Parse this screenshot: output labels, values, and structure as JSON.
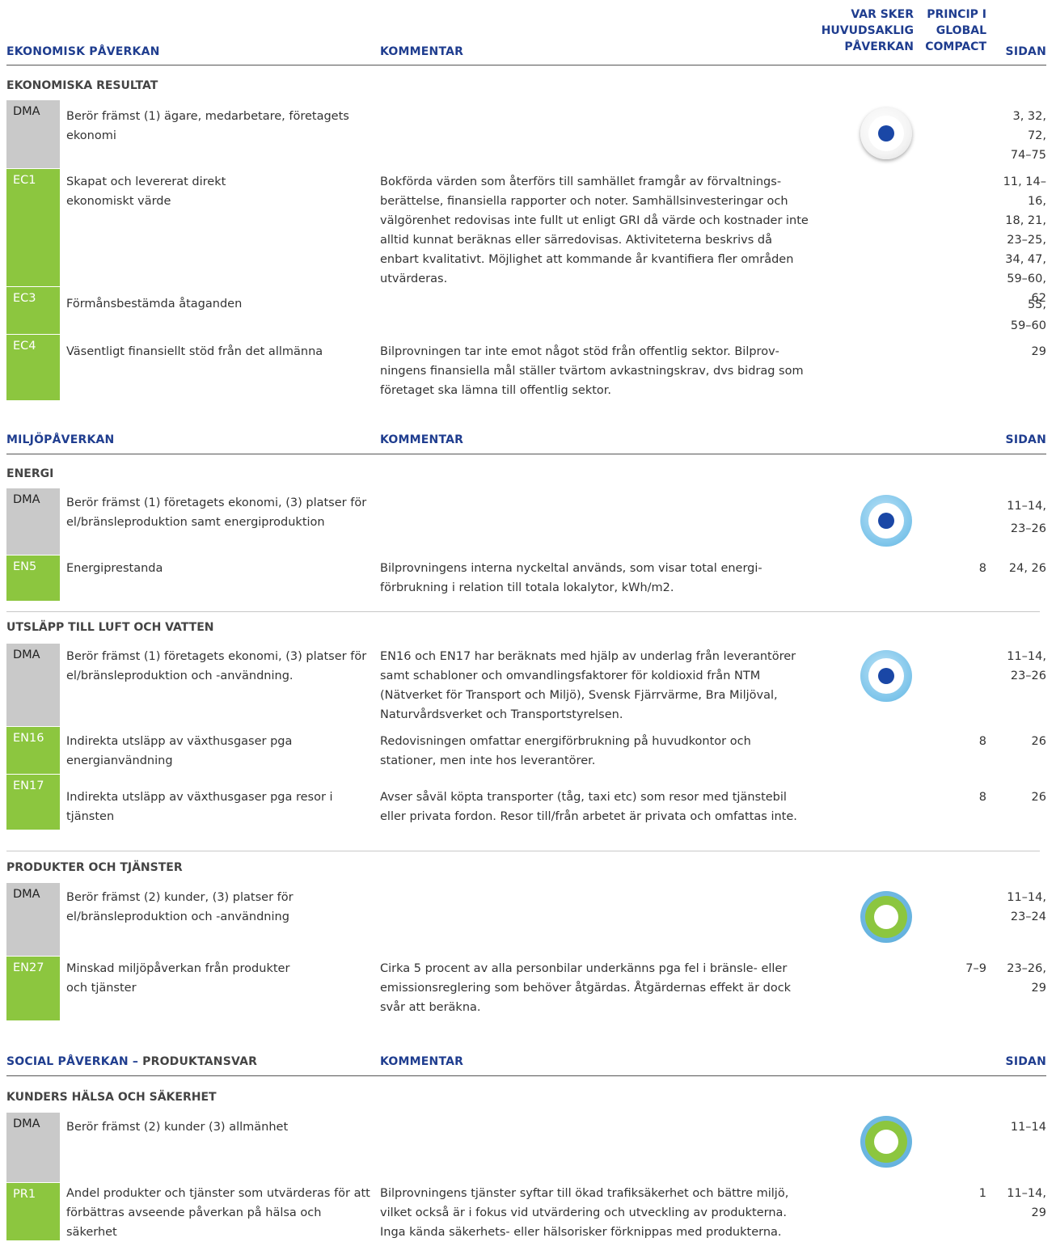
{
  "columns": {
    "var_sker": [
      "VAR SKER",
      "HUVUDSAKLIG",
      "PÅVERKAN"
    ],
    "princip": [
      "PRINCIP I",
      "GLOBAL",
      "COMPACT"
    ],
    "sidan": "SIDAN",
    "kommentar": "KOMMENTAR"
  },
  "sections": {
    "ekonomisk": {
      "title": "EKONOMISK PÅVERKAN",
      "sub": "EKONOMISKA RESULTAT",
      "rows": [
        {
          "code": "DMA",
          "desc": "Berör främst (1) ägare, medarbetare, företagets ekonomi",
          "comment": "",
          "gc": "",
          "pages": "3, 32, 72,\n74–75"
        },
        {
          "code": "EC1",
          "desc": "Skapat och levererat direkt ekonomiskt värde",
          "comment": "Bokförda värden som återförs till samhället framgår av förvaltnings­berättelse, finansiella rapporter och noter. Samhällsinvesteringar och välgörenhet redovisas inte fullt ut enligt GRI då värde och kost­nader inte alltid kunnat beräknas eller särredovisas. Aktiviteterna beskrivs då enbart kvalitativt. Möjlighet att kommande år kvantifi­era fler områden utvärderas.",
          "gc": "",
          "pages": "11, 14–16,\n18, 21,\n23–25,\n34, 47,\n59–60,\n62"
        },
        {
          "code": "EC3",
          "desc": "Förmånsbestämda åtaganden",
          "comment": "",
          "gc": "",
          "pages": "55,\n59–60"
        },
        {
          "code": "EC4",
          "desc": "Väsentligt finansiellt stöd från det allmänna",
          "comment": "Bilprovningen tar inte emot något stöd från offentlig sektor. Bilprov­ningens finansiella mål ställer tvärtom avkastningskrav, dvs bidrag som företaget ska lämna till offentlig sektor.",
          "gc": "",
          "pages": "29"
        }
      ]
    },
    "miljo": {
      "title": "MILJÖPÅVERKAN",
      "energi": {
        "sub": "ENERGI",
        "rows": [
          {
            "code": "DMA",
            "desc": "Berör främst (1) företagets ekonomi, (3) platser för el/bränsleproduktion samt energiproduktion",
            "comment": "",
            "gc": "",
            "pages": "11–14,\n23–26"
          },
          {
            "code": "EN5",
            "desc": "Energiprestanda",
            "comment": "Bilprovningens interna nyckeltal används, som visar total energi­förbrukning i relation till totala lokalytor, kWh/m2.",
            "gc": "8",
            "pages": "24, 26"
          }
        ]
      },
      "utslapp": {
        "sub": "UTSLÄPP TILL LUFT OCH VATTEN",
        "rows": [
          {
            "code": "DMA",
            "desc": "Berör främst (1) företagets ekonomi, (3) platser för el/bränsleproduktion och -användning.",
            "comment": "EN16 och EN17 har beräknats med hjälp av underlag från leverantörer samt schabloner och omvandlingsfaktorer för koldioxid från NTM (Nätverket för Transport och Miljö), Svensk Fjärrvärme, Bra Miljöval, Naturvårdsverket och Transportstyrelsen.",
            "gc": "",
            "pages": "11–14,\n23–26"
          },
          {
            "code": "EN16",
            "desc": "Indirekta utsläpp av växthusgaser pga energianvändning",
            "comment": "Redovisningen omfattar energiförbrukning på huvudkontor och stationer, men inte hos leverantörer.",
            "gc": "8",
            "pages": "26"
          },
          {
            "code": "EN17",
            "desc": "Indirekta utsläpp av växthusgaser pga resor i tjänsten",
            "comment": "Avser såväl köpta transporter (tåg, taxi etc) som resor med tjänstebil eller privata fordon. Resor till/från arbetet är privata och omfattas inte.",
            "gc": "8",
            "pages": "26"
          }
        ]
      },
      "produkter": {
        "sub": "PRODUKTER OCH TJÄNSTER",
        "rows": [
          {
            "code": "DMA",
            "desc": "Berör främst (2) kunder, (3) platser för el/bränsleproduktion och -användning",
            "comment": "",
            "gc": "",
            "pages": "11–14,\n23–24"
          },
          {
            "code": "EN27",
            "desc": "Minskad miljöpåverkan från produkter och tjänster",
            "comment": "Cirka 5 procent av alla personbilar underkänns pga fel i bränsle- eller emissionsreglering som behöver åtgärdas. Åtgärdernas effekt är dock svår att beräkna.",
            "gc": "7–9",
            "pages": "23–26,\n29"
          }
        ]
      }
    },
    "social": {
      "title": "SOCIAL PÅVERKAN – ",
      "title_b": "PRODUKTANSVAR",
      "sub": "KUNDERS HÄLSA OCH SÄKERHET",
      "rows": [
        {
          "code": "DMA",
          "desc": "Berör främst (2) kunder (3) allmänhet",
          "comment": "",
          "gc": "",
          "pages": "11–14"
        },
        {
          "code": "PR1",
          "desc": "Andel produkter och tjänster som utvärderas för att förbättras avseende  påverkan på hälsa och säkerhet",
          "comment": "Bilprovningens tjänster syftar till ökad trafiksäkerhet och bättre miljö, vilket också är i fokus vid utvärdering och utveckling av produkterna. Inga kända säkerhets- eller hälsorisker förknippas med produkterna.",
          "gc": "1",
          "pages": "11–14,\n29"
        }
      ]
    }
  },
  "indicator_icons": [
    "white-circle-icon",
    "blue-circle-icon",
    "blue-circle-icon",
    "green-circle-icon",
    "green-circle-icon"
  ]
}
